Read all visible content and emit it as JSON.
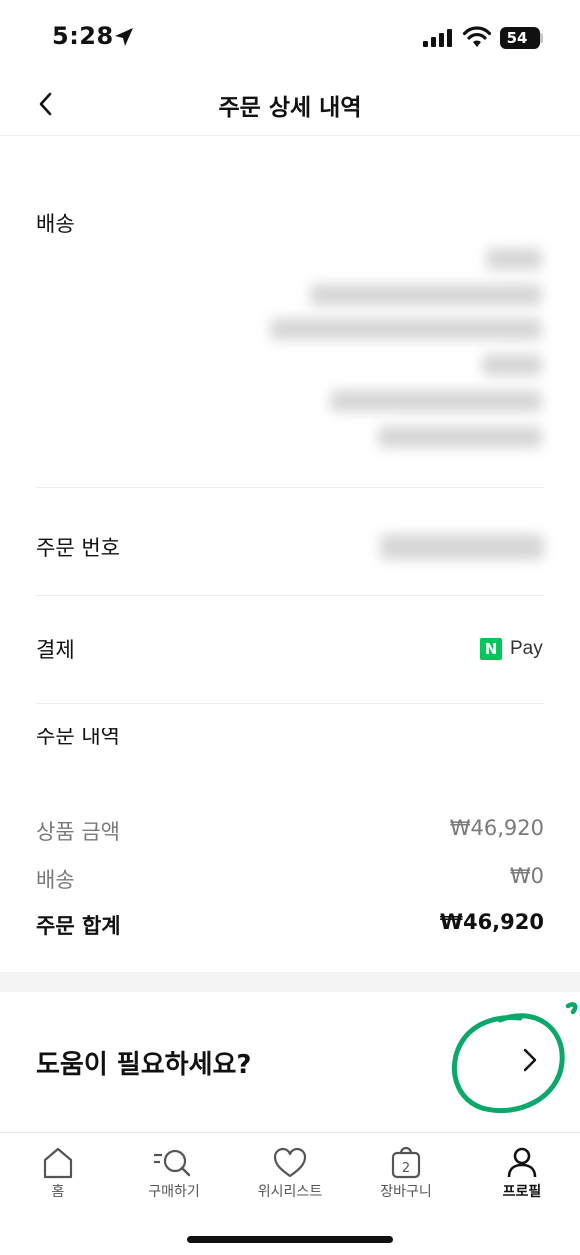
{
  "status": {
    "time": "5:28",
    "battery": "54"
  },
  "header": {
    "title": "주문 상세 내역"
  },
  "shipping": {
    "title": "배송"
  },
  "order_number": {
    "label": "주문 번호"
  },
  "payment": {
    "label": "결제",
    "method_logo": "N",
    "method_text": "Pay"
  },
  "cutoff_label": "주문 내역",
  "summary": {
    "product_label": "상품 금액",
    "product_value": "₩46,920",
    "shipping_label": "배송",
    "shipping_value": "₩0",
    "total_label": "주문 합계",
    "total_value": "₩46,920"
  },
  "help": {
    "text": "도움이 필요하세요?"
  },
  "tabs": [
    {
      "label": "홈",
      "icon": "home-icon"
    },
    {
      "label": "구매하기",
      "icon": "search-list-icon"
    },
    {
      "label": "위시리스트",
      "icon": "heart-icon"
    },
    {
      "label": "장바구니",
      "icon": "bag-icon",
      "badge": "2"
    },
    {
      "label": "프로필",
      "icon": "profile-icon",
      "active": true
    }
  ],
  "colors": {
    "npay_green": "#03c75a",
    "annotation_green": "#0aa86a"
  }
}
